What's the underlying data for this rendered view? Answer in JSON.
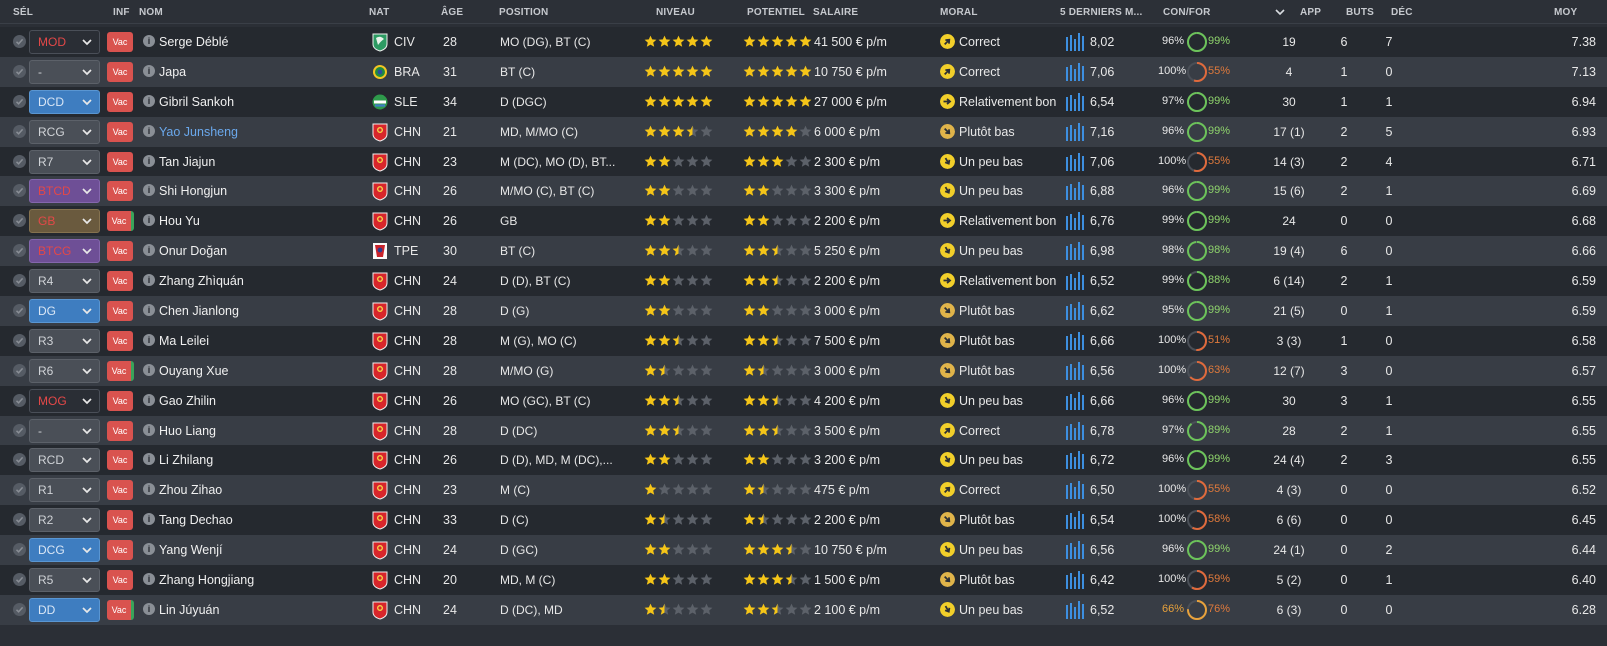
{
  "header": {
    "sel": "SÉL",
    "inf": "INF",
    "nom": "NOM",
    "nat": "NAT",
    "age": "ÂGE",
    "position": "POSITION",
    "niveau": "NIVEAU",
    "potentiel": "POTENTIEL",
    "salaire": "SALAIRE",
    "moral": "MORAL",
    "derniers": "5 DERNIERS M...",
    "confor": "CON/FOR",
    "app": "APP",
    "buts": "BUTS",
    "dec": "DÉC",
    "moy": "MOY"
  },
  "colors": {
    "vac": "#d9534f",
    "link": "#6aa8ec",
    "star": "#f5c518",
    "fit_green": "#8fd46c",
    "fit_orange": "#e07a3c"
  },
  "players": [
    {
      "sel": "MOD",
      "sel_style": "plain",
      "vac": "Vac",
      "name": "Serge Déblé",
      "flag": "civ",
      "nat": "CIV",
      "age": "28",
      "position": "MO (DG), BT (C)",
      "niveau": 5,
      "potentiel": 5,
      "salaire": "41 500 € p/m",
      "moral": "Correct",
      "moral_icon": "up-right",
      "forme": "8,02",
      "con": "96%",
      "fit": "99%",
      "fit_val": 99,
      "app": "19",
      "buts": "6",
      "dec": "7",
      "moy": "7.38"
    },
    {
      "sel": "-",
      "sel_style": "grey",
      "vac": "Vac",
      "name": "Japa",
      "flag": "bra",
      "nat": "BRA",
      "age": "31",
      "position": "BT (C)",
      "niveau": 5,
      "potentiel": 5,
      "salaire": "10 750 € p/m",
      "moral": "Correct",
      "moral_icon": "up-right",
      "forme": "7,06",
      "con": "100%",
      "fit": "55%",
      "fit_val": 55,
      "app": "4",
      "buts": "1",
      "dec": "0",
      "moy": "7.13"
    },
    {
      "sel": "DCD",
      "sel_style": "blue",
      "vac": "Vac",
      "name": "Gibril Sankoh",
      "flag": "sle",
      "nat": "SLE",
      "age": "34",
      "position": "D (DGC)",
      "niveau": 5,
      "potentiel": 5,
      "salaire": "27 000 € p/m",
      "moral": "Relativement bon",
      "moral_icon": "right",
      "forme": "6,54",
      "con": "97%",
      "fit": "99%",
      "fit_val": 99,
      "app": "30",
      "buts": "1",
      "dec": "1",
      "moy": "6.94"
    },
    {
      "sel": "RCG",
      "sel_style": "grey",
      "vac": "Vac",
      "name": "Yao Junsheng",
      "link": true,
      "flag": "chn",
      "nat": "CHN",
      "age": "21",
      "position": "MD, M/MO (C)",
      "niveau": 3.5,
      "potentiel": 4,
      "salaire": "6 000 € p/m",
      "moral": "Plutôt bas",
      "moral_icon": "down-right",
      "forme": "7,16",
      "con": "96%",
      "fit": "99%",
      "fit_val": 99,
      "app": "17 (1)",
      "buts": "2",
      "dec": "5",
      "moy": "6.93"
    },
    {
      "sel": "R7",
      "sel_style": "grey",
      "vac": "Vac",
      "name": "Tan Jiajun",
      "flag": "chn",
      "nat": "CHN",
      "age": "23",
      "position": "M (DC), MO (D), BT...",
      "niveau": 2,
      "potentiel": 3,
      "salaire": "2 300 € p/m",
      "moral": "Un peu bas",
      "moral_icon": "down",
      "forme": "7,06",
      "con": "100%",
      "fit": "55%",
      "fit_val": 55,
      "app": "14 (3)",
      "buts": "2",
      "dec": "4",
      "moy": "6.71"
    },
    {
      "sel": "BTCD",
      "sel_style": "purple",
      "vac": "Vac",
      "name": "Shi Hongjun",
      "flag": "chn",
      "nat": "CHN",
      "age": "26",
      "position": "M/MO (C), BT (C)",
      "niveau": 2,
      "potentiel": 2,
      "salaire": "3 300 € p/m",
      "moral": "Un peu bas",
      "moral_icon": "down",
      "forme": "6,88",
      "con": "96%",
      "fit": "99%",
      "fit_val": 99,
      "app": "15 (6)",
      "buts": "2",
      "dec": "1",
      "moy": "6.69"
    },
    {
      "sel": "GB",
      "sel_style": "brown",
      "vac": "Vac",
      "vac_gb": true,
      "name": "Hou Yu",
      "flag": "chn",
      "nat": "CHN",
      "age": "26",
      "position": "GB",
      "niveau": 2,
      "potentiel": 2,
      "salaire": "2 200 € p/m",
      "moral": "Relativement bon",
      "moral_icon": "right",
      "forme": "6,76",
      "con": "99%",
      "fit": "99%",
      "fit_val": 99,
      "app": "24",
      "buts": "0",
      "dec": "0",
      "moy": "6.68"
    },
    {
      "sel": "BTCG",
      "sel_style": "purple",
      "vac": "Vac",
      "name": "Onur Doğan",
      "flag": "tpe",
      "nat": "TPE",
      "age": "30",
      "position": "BT (C)",
      "niveau": 2.5,
      "potentiel": 2.5,
      "salaire": "5 250 € p/m",
      "moral": "Un peu bas",
      "moral_icon": "down",
      "forme": "6,98",
      "con": "98%",
      "fit": "98%",
      "fit_val": 98,
      "app": "19 (4)",
      "buts": "6",
      "dec": "0",
      "moy": "6.66"
    },
    {
      "sel": "R4",
      "sel_style": "grey",
      "vac": "Vac",
      "name": "Zhang Zhìquán",
      "flag": "chn",
      "nat": "CHN",
      "age": "24",
      "position": "D (D), BT (C)",
      "niveau": 2,
      "potentiel": 2.5,
      "salaire": "2 200 € p/m",
      "moral": "Relativement bon",
      "moral_icon": "right",
      "forme": "6,52",
      "con": "99%",
      "fit": "88%",
      "fit_val": 88,
      "app": "6 (14)",
      "buts": "2",
      "dec": "1",
      "moy": "6.59"
    },
    {
      "sel": "DG",
      "sel_style": "blue",
      "vac": "Vac",
      "name": "Chen Jianlong",
      "flag": "chn",
      "nat": "CHN",
      "age": "28",
      "position": "D (G)",
      "niveau": 2,
      "potentiel": 2,
      "salaire": "3 000 € p/m",
      "moral": "Plutôt bas",
      "moral_icon": "down-right",
      "forme": "6,62",
      "con": "95%",
      "fit": "99%",
      "fit_val": 99,
      "app": "21 (5)",
      "buts": "0",
      "dec": "1",
      "moy": "6.59"
    },
    {
      "sel": "R3",
      "sel_style": "grey",
      "vac": "Vac",
      "name": "Ma Leilei",
      "flag": "chn",
      "nat": "CHN",
      "age": "28",
      "position": "M (G), MO (C)",
      "niveau": 2.5,
      "potentiel": 2.5,
      "salaire": "7 500 € p/m",
      "moral": "Plutôt bas",
      "moral_icon": "down-right",
      "forme": "6,66",
      "con": "100%",
      "fit": "51%",
      "fit_val": 51,
      "app": "3 (3)",
      "buts": "1",
      "dec": "0",
      "moy": "6.58"
    },
    {
      "sel": "R6",
      "sel_style": "grey",
      "vac": "Vac",
      "vac_gb": true,
      "name": "Ouyang Xue",
      "flag": "chn",
      "nat": "CHN",
      "age": "28",
      "position": "M/MO (G)",
      "niveau": 1.5,
      "potentiel": 1.5,
      "salaire": "3 000 € p/m",
      "moral": "Plutôt bas",
      "moral_icon": "down-right",
      "forme": "6,56",
      "con": "100%",
      "fit": "63%",
      "fit_val": 63,
      "app": "12 (7)",
      "buts": "3",
      "dec": "0",
      "moy": "6.57"
    },
    {
      "sel": "MOG",
      "sel_style": "plain",
      "vac": "Vac",
      "name": "Gao Zhilin",
      "flag": "chn",
      "nat": "CHN",
      "age": "26",
      "position": "MO (GC), BT (C)",
      "niveau": 2.5,
      "potentiel": 2.5,
      "salaire": "4 200 € p/m",
      "moral": "Un peu bas",
      "moral_icon": "down",
      "forme": "6,66",
      "con": "96%",
      "fit": "99%",
      "fit_val": 99,
      "app": "30",
      "buts": "3",
      "dec": "1",
      "moy": "6.55"
    },
    {
      "sel": "-",
      "sel_style": "grey",
      "vac": "Vac",
      "name": "Huo Liang",
      "flag": "chn",
      "nat": "CHN",
      "age": "28",
      "position": "D (DC)",
      "niveau": 2.5,
      "potentiel": 2.5,
      "salaire": "3 500 € p/m",
      "moral": "Correct",
      "moral_icon": "up-right",
      "forme": "6,78",
      "con": "97%",
      "fit": "89%",
      "fit_val": 89,
      "app": "28",
      "buts": "2",
      "dec": "1",
      "moy": "6.55"
    },
    {
      "sel": "RCD",
      "sel_style": "grey",
      "vac": "Vac",
      "name": "Li Zhilang",
      "flag": "chn",
      "nat": "CHN",
      "age": "26",
      "position": "D (D), MD, M (DC),...",
      "niveau": 2,
      "potentiel": 2,
      "salaire": "3 200 € p/m",
      "moral": "Un peu bas",
      "moral_icon": "down",
      "forme": "6,72",
      "con": "96%",
      "fit": "99%",
      "fit_val": 99,
      "app": "24 (4)",
      "buts": "2",
      "dec": "3",
      "moy": "6.55"
    },
    {
      "sel": "R1",
      "sel_style": "grey",
      "vac": "Vac",
      "name": "Zhou Zihao",
      "flag": "chn",
      "nat": "CHN",
      "age": "23",
      "position": "M (C)",
      "niveau": 1,
      "potentiel": 1.5,
      "salaire": "475 € p/m",
      "moral": "Correct",
      "moral_icon": "up-right",
      "forme": "6,50",
      "con": "100%",
      "fit": "55%",
      "fit_val": 55,
      "app": "4 (3)",
      "buts": "0",
      "dec": "0",
      "moy": "6.52"
    },
    {
      "sel": "R2",
      "sel_style": "grey",
      "vac": "Vac",
      "name": "Tang Dechao",
      "flag": "chn",
      "nat": "CHN",
      "age": "33",
      "position": "D (C)",
      "niveau": 1.5,
      "potentiel": 1.5,
      "salaire": "2 200 € p/m",
      "moral": "Plutôt bas",
      "moral_icon": "down-right",
      "forme": "6,54",
      "con": "100%",
      "fit": "58%",
      "fit_val": 58,
      "app": "6 (6)",
      "buts": "0",
      "dec": "0",
      "moy": "6.45"
    },
    {
      "sel": "DCG",
      "sel_style": "blue",
      "vac": "Vac",
      "name": "Yang Wenjí",
      "flag": "chn",
      "nat": "CHN",
      "age": "24",
      "position": "D (GC)",
      "niveau": 2,
      "potentiel": 3.5,
      "salaire": "10 750 € p/m",
      "moral": "Un peu bas",
      "moral_icon": "down",
      "forme": "6,56",
      "con": "96%",
      "fit": "99%",
      "fit_val": 99,
      "app": "24 (1)",
      "buts": "0",
      "dec": "2",
      "moy": "6.44"
    },
    {
      "sel": "R5",
      "sel_style": "grey",
      "vac": "Vac",
      "name": "Zhang Hongjiang",
      "flag": "chn",
      "nat": "CHN",
      "age": "20",
      "position": "MD, M (C)",
      "niveau": 2,
      "potentiel": 3.5,
      "salaire": "1 500 € p/m",
      "moral": "Plutôt bas",
      "moral_icon": "down-right",
      "forme": "6,42",
      "con": "100%",
      "fit": "59%",
      "fit_val": 59,
      "app": "5 (2)",
      "buts": "0",
      "dec": "1",
      "moy": "6.40"
    },
    {
      "sel": "DD",
      "sel_style": "blue",
      "vac": "Vac",
      "vac_gb": true,
      "name": "Lin Júyuán",
      "flag": "chn",
      "nat": "CHN",
      "age": "24",
      "position": "D (DC), MD",
      "niveau": 1.5,
      "potentiel": 2.5,
      "salaire": "2 100 € p/m",
      "moral": "Un peu bas",
      "moral_icon": "down",
      "forme": "6,52",
      "con": "66%",
      "con_warn": true,
      "fit": "76%",
      "fit_val": 76,
      "app": "6 (3)",
      "buts": "0",
      "dec": "0",
      "moy": "6.28"
    }
  ]
}
